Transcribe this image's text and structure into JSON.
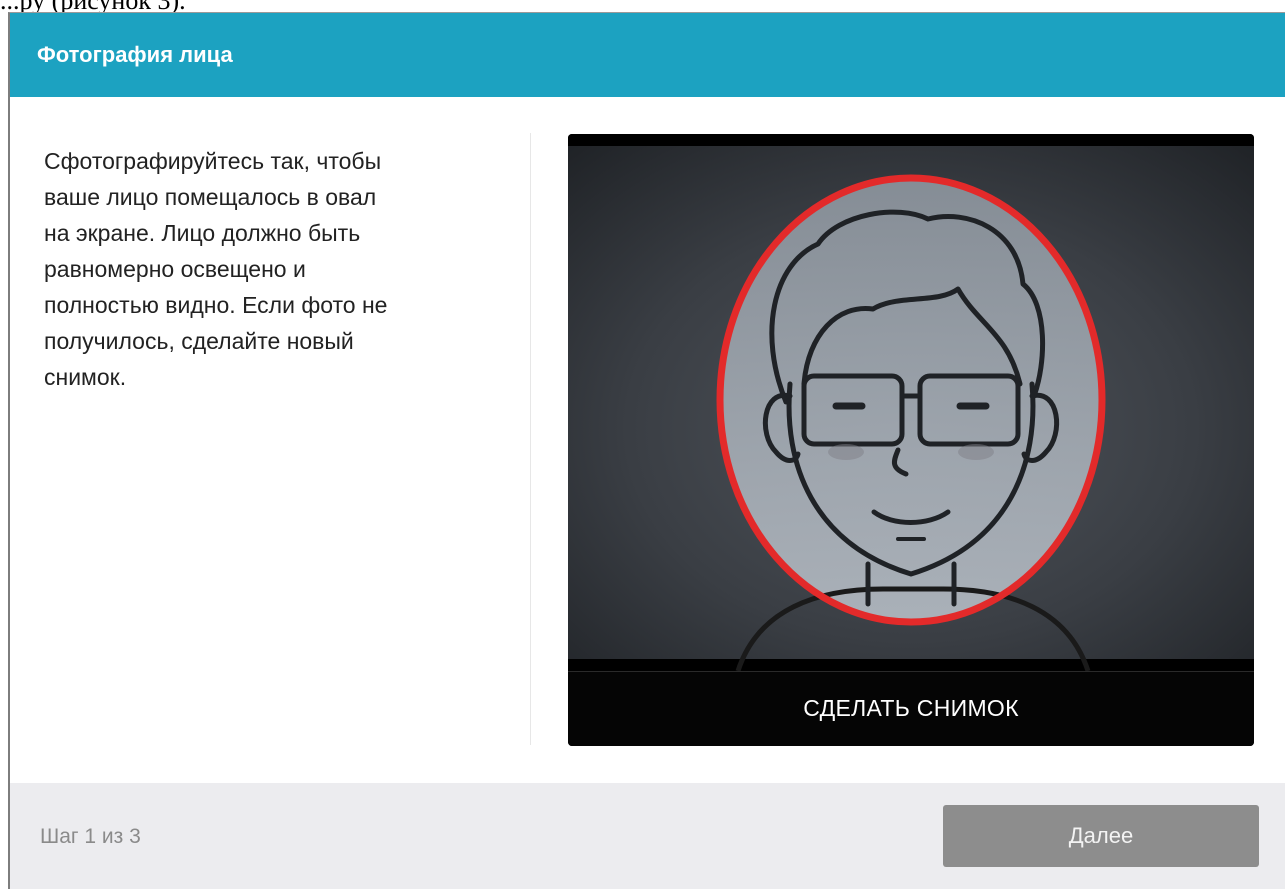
{
  "document_fragment": "...ру (рисунок 3).",
  "dialog": {
    "title": "Фотография лица",
    "instructions": "Сфотографируйтесь так, чтобы\nваше лицо помещалось в овал\nна экране. Лицо должно быть\nравномерно освещено и\nполностью видно. Если фото не\nполучилось, сделайте новый\nснимок.",
    "camera": {
      "capture_label": "СДЕЛАТЬ СНИМОК",
      "oval_color": "#e32a2a",
      "icon": "face-silhouette"
    },
    "footer": {
      "step_text": "Шаг 1 из 3",
      "next_label": "Далее"
    }
  },
  "colors": {
    "header": "#1ca2c1",
    "next_button_disabled": "#8d8d8d",
    "footer_bg": "#ececef"
  }
}
